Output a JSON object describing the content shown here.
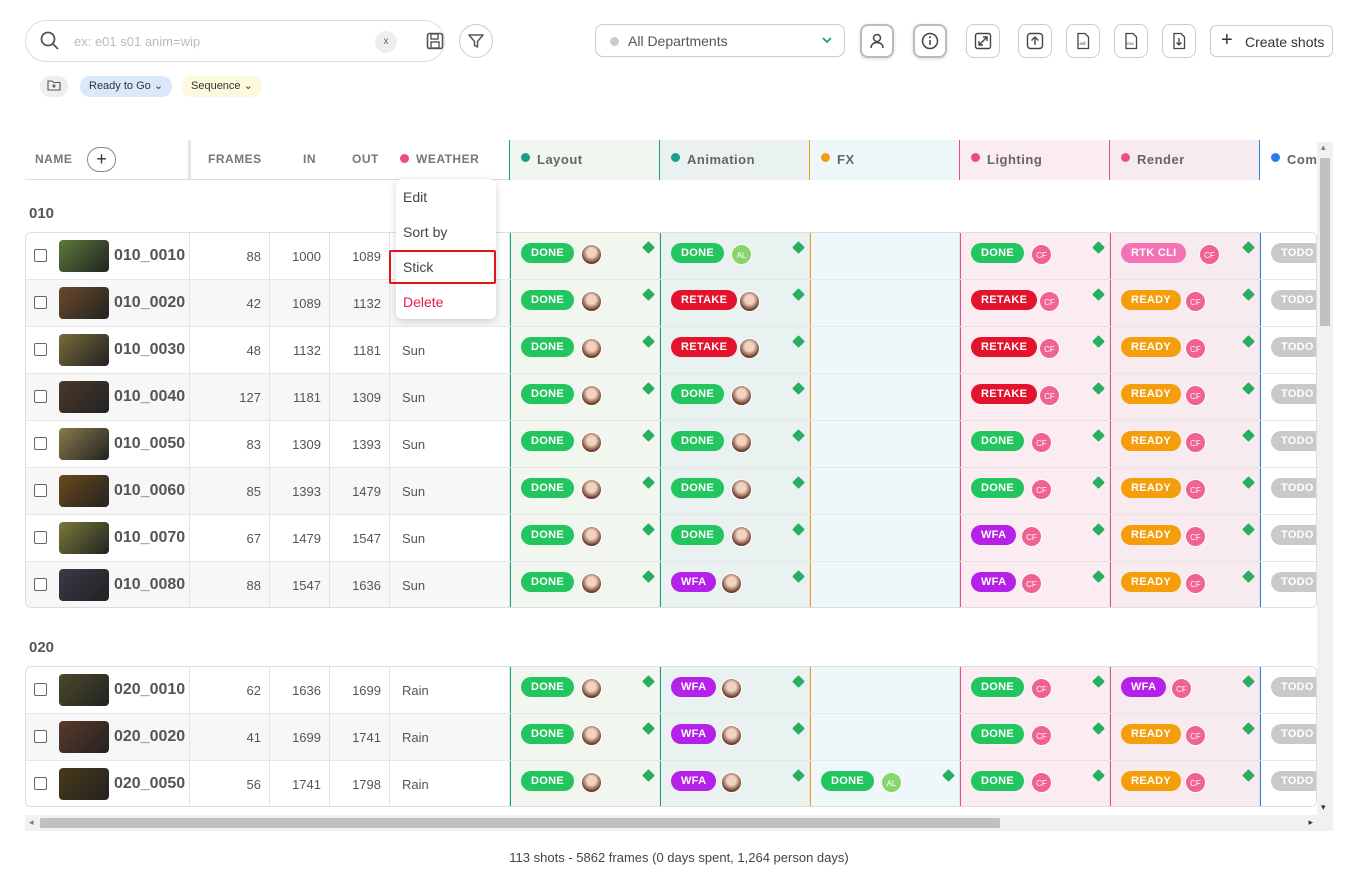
{
  "search": {
    "placeholder": "ex: e01 s01 anim=wip",
    "clear": "x"
  },
  "department": {
    "selected": "All Departments"
  },
  "create_label": "Create shots",
  "chips": {
    "ready": "Ready to Go",
    "sequence": "Sequence"
  },
  "columns": {
    "name": "NAME",
    "frames": "FRAMES",
    "in": "IN",
    "out": "OUT",
    "weather": "WEATHER"
  },
  "tasks": [
    {
      "name": "Layout",
      "color": "#16a085",
      "bg": "#f1f6ee"
    },
    {
      "name": "Animation",
      "color": "#16a085",
      "bg": "#e9f2f1"
    },
    {
      "name": "FX",
      "color": "#f39c12",
      "bg": "#eef7f9"
    },
    {
      "name": "Lighting",
      "color": "#e84f8a",
      "bg": "#fbecf1"
    },
    {
      "name": "Render",
      "color": "#e84f8a",
      "bg": "#f8ebef"
    },
    {
      "name": "Com",
      "color": "#2b7de9",
      "bg": "#fff"
    }
  ],
  "status_colors": {
    "DONE": "#22c55e",
    "RETAKE": "#e3132d",
    "READY": "#f59e0b",
    "WFA": "#b521e8",
    "RTK CLI": "#f472b6",
    "TODO": "#c9c9c9"
  },
  "context_menu": {
    "edit": "Edit",
    "sort_by": "Sort by",
    "stick": "Stick",
    "delete": "Delete"
  },
  "groups": [
    {
      "name": "010",
      "shots": [
        {
          "name": "010_0010",
          "frames": "88",
          "in": "1000",
          "out": "1089",
          "weather": "",
          "tasks": [
            "DONE",
            "DONE",
            "",
            "DONE",
            "RTK CLI",
            "TODO"
          ]
        },
        {
          "name": "010_0020",
          "frames": "42",
          "in": "1089",
          "out": "1132",
          "weather": "",
          "tasks": [
            "DONE",
            "RETAKE",
            "",
            "RETAKE",
            "READY",
            "TODO"
          ]
        },
        {
          "name": "010_0030",
          "frames": "48",
          "in": "1132",
          "out": "1181",
          "weather": "Sun",
          "tasks": [
            "DONE",
            "RETAKE",
            "",
            "RETAKE",
            "READY",
            "TODO"
          ]
        },
        {
          "name": "010_0040",
          "frames": "127",
          "in": "1181",
          "out": "1309",
          "weather": "Sun",
          "tasks": [
            "DONE",
            "DONE",
            "",
            "RETAKE",
            "READY",
            "TODO"
          ]
        },
        {
          "name": "010_0050",
          "frames": "83",
          "in": "1309",
          "out": "1393",
          "weather": "Sun",
          "tasks": [
            "DONE",
            "DONE",
            "",
            "DONE",
            "READY",
            "TODO"
          ]
        },
        {
          "name": "010_0060",
          "frames": "85",
          "in": "1393",
          "out": "1479",
          "weather": "Sun",
          "tasks": [
            "DONE",
            "DONE",
            "",
            "DONE",
            "READY",
            "TODO"
          ]
        },
        {
          "name": "010_0070",
          "frames": "67",
          "in": "1479",
          "out": "1547",
          "weather": "Sun",
          "tasks": [
            "DONE",
            "DONE",
            "",
            "WFA",
            "READY",
            "TODO"
          ]
        },
        {
          "name": "010_0080",
          "frames": "88",
          "in": "1547",
          "out": "1636",
          "weather": "Sun",
          "tasks": [
            "DONE",
            "WFA",
            "",
            "WFA",
            "READY",
            "TODO"
          ]
        }
      ]
    },
    {
      "name": "020",
      "shots": [
        {
          "name": "020_0010",
          "frames": "62",
          "in": "1636",
          "out": "1699",
          "weather": "Rain",
          "tasks": [
            "DONE",
            "WFA",
            "",
            "DONE",
            "WFA",
            "TODO"
          ]
        },
        {
          "name": "020_0020",
          "frames": "41",
          "in": "1699",
          "out": "1741",
          "weather": "Rain",
          "tasks": [
            "DONE",
            "WFA",
            "",
            "DONE",
            "READY",
            "TODO"
          ]
        },
        {
          "name": "020_0050",
          "frames": "56",
          "in": "1741",
          "out": "1798",
          "weather": "Rain",
          "tasks": [
            "DONE",
            "WFA",
            "DONE",
            "DONE",
            "READY",
            "TODO"
          ]
        }
      ]
    }
  ],
  "avatar_labels": {
    "cf": "CF",
    "al": "AL"
  },
  "footer": "113 shots - 5862 frames (0 days spent, 1,264 person days)"
}
